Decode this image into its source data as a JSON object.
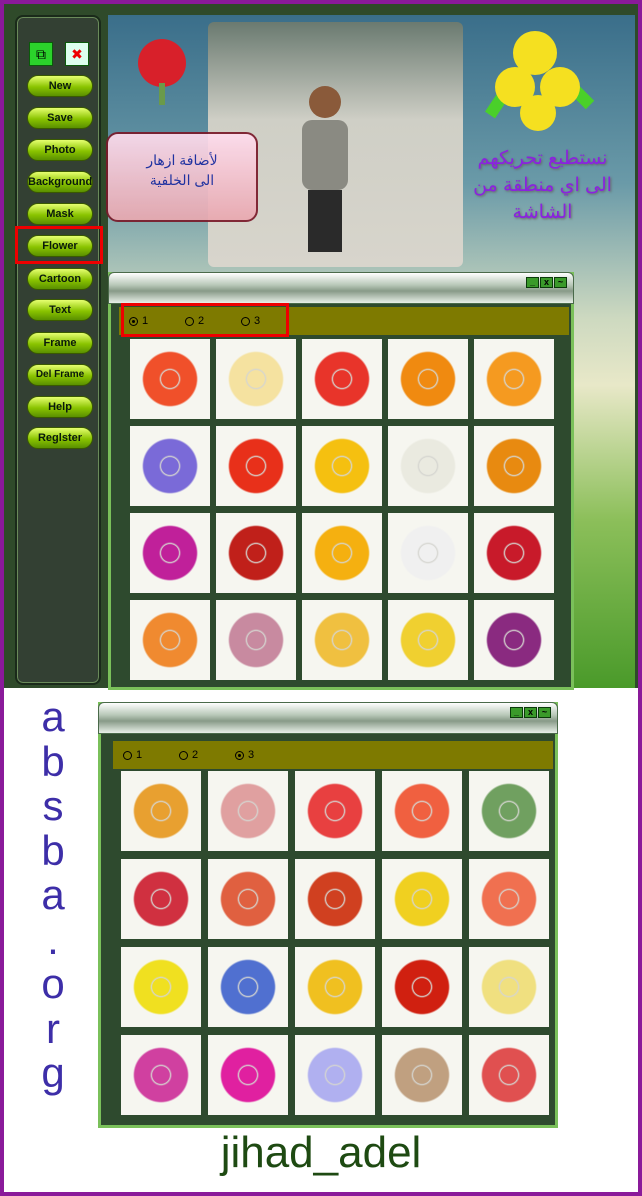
{
  "sidebar": {
    "icons": [
      {
        "name": "copy-icon",
        "glyph": "⧉"
      },
      {
        "name": "close-document-icon",
        "glyph": "✖"
      }
    ],
    "buttons": [
      "New",
      "Save",
      "Photo",
      "Background",
      "Mask",
      "Flower",
      "Cartoon",
      "Text",
      "Frame",
      "Del Frame",
      "Help",
      "Reglster"
    ],
    "highlighted": "Flower"
  },
  "tooltip": {
    "line1": "لأضافة ازهار",
    "line2": "الى الخلفية"
  },
  "caption": {
    "line1": "نستطيع تحريكهم",
    "line2": "الى اي منطقة من",
    "line3": "الشاشة"
  },
  "window1": {
    "radios": [
      "1",
      "2",
      "3"
    ],
    "selected": 0,
    "flowers": [
      "#f0502a",
      "#f5e2a0",
      "#e8342a",
      "#f08a10",
      "#f59a20",
      "#7a6ad8",
      "#e8301a",
      "#f5c010",
      "#eaeae0",
      "#e88a10",
      "#c0209a",
      "#c0201a",
      "#f5b010",
      "#f0f0f0",
      "#c81a2a",
      "#f08a30",
      "#c88aa0",
      "#f0c040",
      "#f0d030",
      "#8a2a80"
    ]
  },
  "window2": {
    "radios": [
      "1",
      "2",
      "3"
    ],
    "selected": 2,
    "flowers": [
      "#e8a030",
      "#e0a0a0",
      "#e84040",
      "#f06040",
      "#70a060",
      "#d03040",
      "#e06040",
      "#d04020",
      "#f0d020",
      "#f07050",
      "#f0e020",
      "#5070d0",
      "#f0c020",
      "#d02010",
      "#f0e080",
      "#d040a0",
      "#e020a0",
      "#b0b0f0",
      "#c0a080",
      "#e05050"
    ]
  },
  "site_letters": [
    "a",
    "b",
    "s",
    "b",
    "a",
    ".",
    "o",
    "r",
    "g"
  ],
  "author": "jihad_adel"
}
